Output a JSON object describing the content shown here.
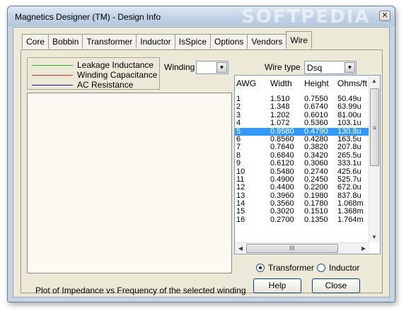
{
  "window": {
    "title": "Magnetics Designer (TM) - Design Info",
    "watermark": "SOFTPEDIA",
    "close_glyph": "✕"
  },
  "tabs": [
    "Core",
    "Bobbin",
    "Transformer",
    "Inductor",
    "IsSpice",
    "Options",
    "Vendors",
    "Wire"
  ],
  "active_tab": "Wire",
  "legend": {
    "items": [
      {
        "label": "Leakage Inductance",
        "color": "#33b233"
      },
      {
        "label": "Winding Capacitance",
        "color": "#c0392b"
      },
      {
        "label": "AC Resistance",
        "color": "#1a1a8c"
      }
    ]
  },
  "winding": {
    "label": "Winding",
    "value": ""
  },
  "wire_type": {
    "label": "Wire type",
    "value": "Dsq"
  },
  "table": {
    "headers": [
      "AWG",
      "Width",
      "Height",
      "Ohms/ft"
    ],
    "rows": [
      [
        "1",
        "1.510",
        "0.7550",
        "50.49u"
      ],
      [
        "2",
        "1.348",
        "0.6740",
        "63.99u"
      ],
      [
        "3",
        "1.202",
        "0.6010",
        "81.00u"
      ],
      [
        "4",
        "1.072",
        "0.5360",
        "103.1u"
      ],
      [
        "5",
        "0.9580",
        "0.4790",
        "130.8u"
      ],
      [
        "6",
        "0.8560",
        "0.4280",
        "163.5u"
      ],
      [
        "7",
        "0.7640",
        "0.3820",
        "207.8u"
      ],
      [
        "8",
        "0.6840",
        "0.3420",
        "265.5u"
      ],
      [
        "9",
        "0.6120",
        "0.3060",
        "333.1u"
      ],
      [
        "10",
        "0.5480",
        "0.2740",
        "425.6u"
      ],
      [
        "11",
        "0.4900",
        "0.2450",
        "525.7u"
      ],
      [
        "12",
        "0.4400",
        "0.2200",
        "672.0u"
      ],
      [
        "13",
        "0.3960",
        "0.1980",
        "837.8u"
      ],
      [
        "14",
        "0.3560",
        "0.1780",
        "1.068m"
      ],
      [
        "15",
        "0.3020",
        "0.1510",
        "1.368m"
      ],
      [
        "16",
        "0.2700",
        "0.1350",
        "1.764m"
      ]
    ],
    "selected_index": 4
  },
  "mode": {
    "options": [
      "Transformer",
      "Inductor"
    ],
    "selected": "Transformer"
  },
  "buttons": {
    "help": "Help",
    "close": "Close"
  },
  "plot_caption": "Plot of Impedance vs Frequency of the selected winding"
}
